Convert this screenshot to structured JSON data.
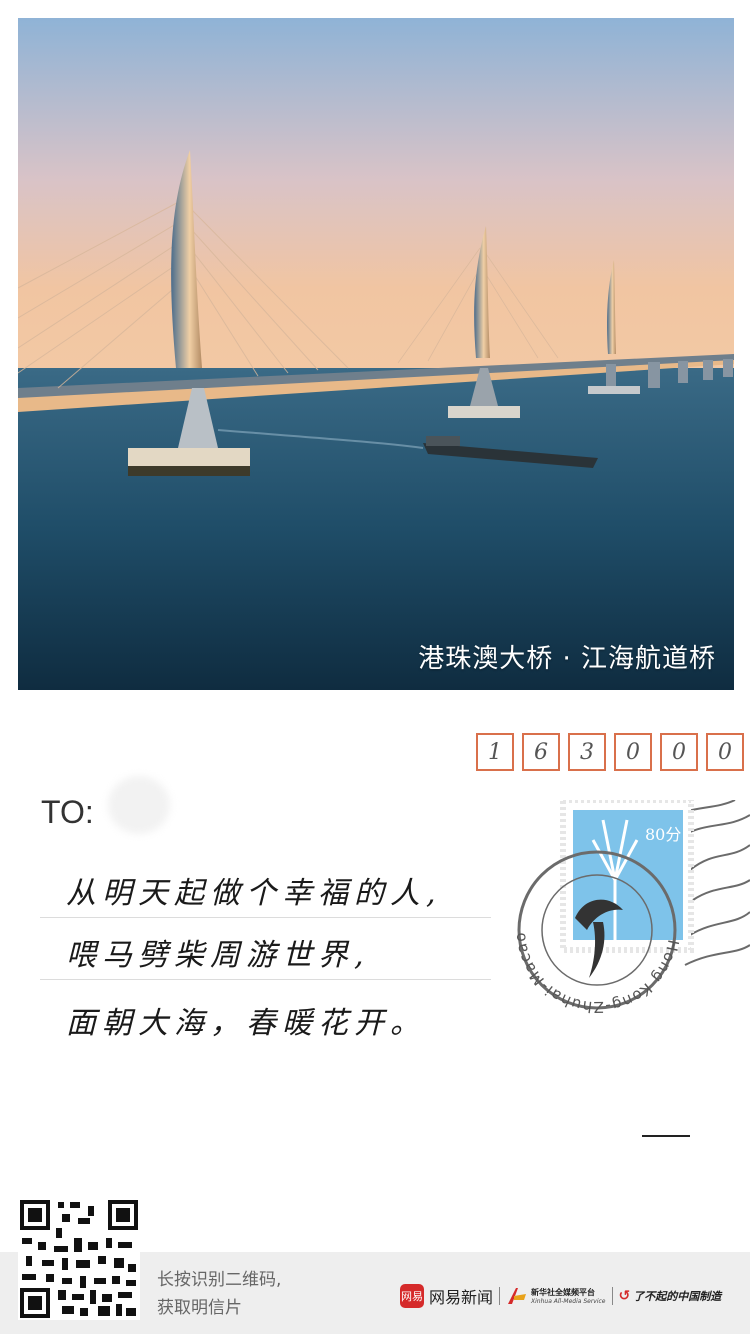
{
  "photo": {
    "caption": "港珠澳大桥 · 江海航道桥"
  },
  "postcard": {
    "postcode_digits": [
      "1",
      "6",
      "3",
      "0",
      "0",
      "0"
    ],
    "to_label": "TO:",
    "message_lines": [
      "从明天起做个幸福的人,",
      "喂马劈柴周游世界,",
      "面朝大海，春暖花开。"
    ],
    "stamp": {
      "value": "80分",
      "postmark_text": "Hong Kong-Zhuhai-Macao Bridge"
    }
  },
  "footer": {
    "hint_line1": "长按识别二维码,",
    "hint_line2": "获取明信片",
    "netease_badge": "网易",
    "netease_name": "网易新闻",
    "xinhua_cn": "新华社全媒频平台",
    "xinhua_en": "Xinhua All-Media Service",
    "china_made": "了不起的中国制造"
  },
  "colors": {
    "postcode_border": "#d9704b",
    "stamp_blue": "#7ec3ea",
    "netease_red": "#d52a2a"
  }
}
